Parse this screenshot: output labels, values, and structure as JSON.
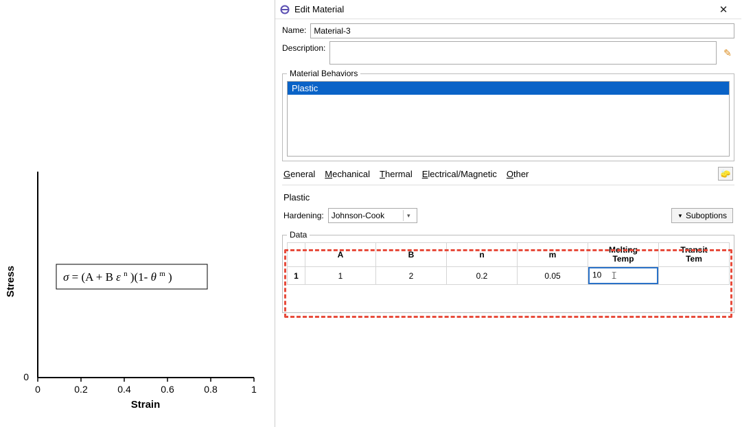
{
  "chart": {
    "xlabel": "Strain",
    "ylabel": "Stress",
    "x_ticks": [
      "0",
      "0.2",
      "0.4",
      "0.6",
      "0.8",
      "1"
    ],
    "y_zero": "0",
    "formula_plain": "σ = (A + Bεⁿ)(1-θᵐ)"
  },
  "chart_data": {
    "type": "line",
    "title": "",
    "xlabel": "Strain",
    "ylabel": "Stress",
    "xlim": [
      0,
      1
    ],
    "x_ticks": [
      0,
      0.2,
      0.4,
      0.6,
      0.8,
      1
    ],
    "series": [],
    "annotations": [
      "σ = (A + Bε^n)(1-θ^m)"
    ]
  },
  "dialog": {
    "title": "Edit Material",
    "name_label": "Name:",
    "name_value": "Material-3",
    "desc_label": "Description:",
    "desc_value": "",
    "behaviors_legend": "Material Behaviors",
    "behaviors": [
      {
        "label": "Plastic",
        "selected": true
      }
    ],
    "menus": {
      "general": "General",
      "mechanical": "Mechanical",
      "thermal": "Thermal",
      "electrical": "Electrical/Magnetic",
      "other": "Other"
    },
    "section_title": "Plastic",
    "hardening_label": "Hardening:",
    "hardening_value": "Johnson-Cook",
    "suboptions_label": "Suboptions",
    "data_legend": "Data",
    "columns": [
      "A",
      "B",
      "n",
      "m",
      "Melting\nTemp",
      "Transit\nTem"
    ],
    "row_index": "1",
    "row": {
      "A": "1",
      "B": "2",
      "n": "0.2",
      "m": "0.05",
      "melting_temp": "10",
      "transition_temp": ""
    }
  }
}
